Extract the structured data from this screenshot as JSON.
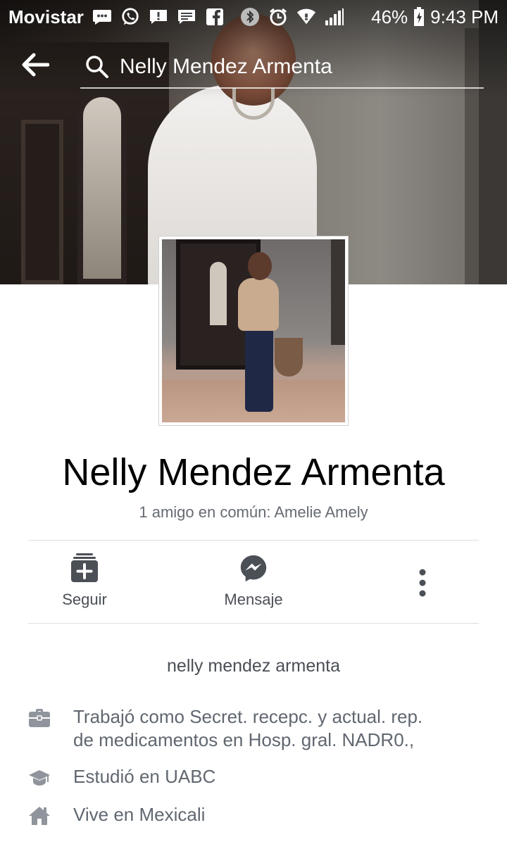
{
  "status_bar": {
    "carrier": "Movistar",
    "battery": "46%",
    "time": "9:43 PM"
  },
  "search": {
    "query": "Nelly Mendez Armenta"
  },
  "profile": {
    "name": "Nelly Mendez Armenta",
    "mutual_friends": "1 amigo en común: Amelie Amely"
  },
  "actions": {
    "follow_label": "Seguir",
    "message_label": "Mensaje"
  },
  "intro": {
    "display_name": "nelly mendez armenta",
    "work_line1": "Trabajó como Secret. recepc. y actual. rep.",
    "work_line2": "de medicamentos en Hosp. gral. NADR0.,",
    "education": "Estudió en UABC",
    "lives": "Vive en Mexicali"
  },
  "colors": {
    "icon_gray": "#90949c",
    "text_gray": "#606770",
    "divider": "#dddfe2"
  }
}
